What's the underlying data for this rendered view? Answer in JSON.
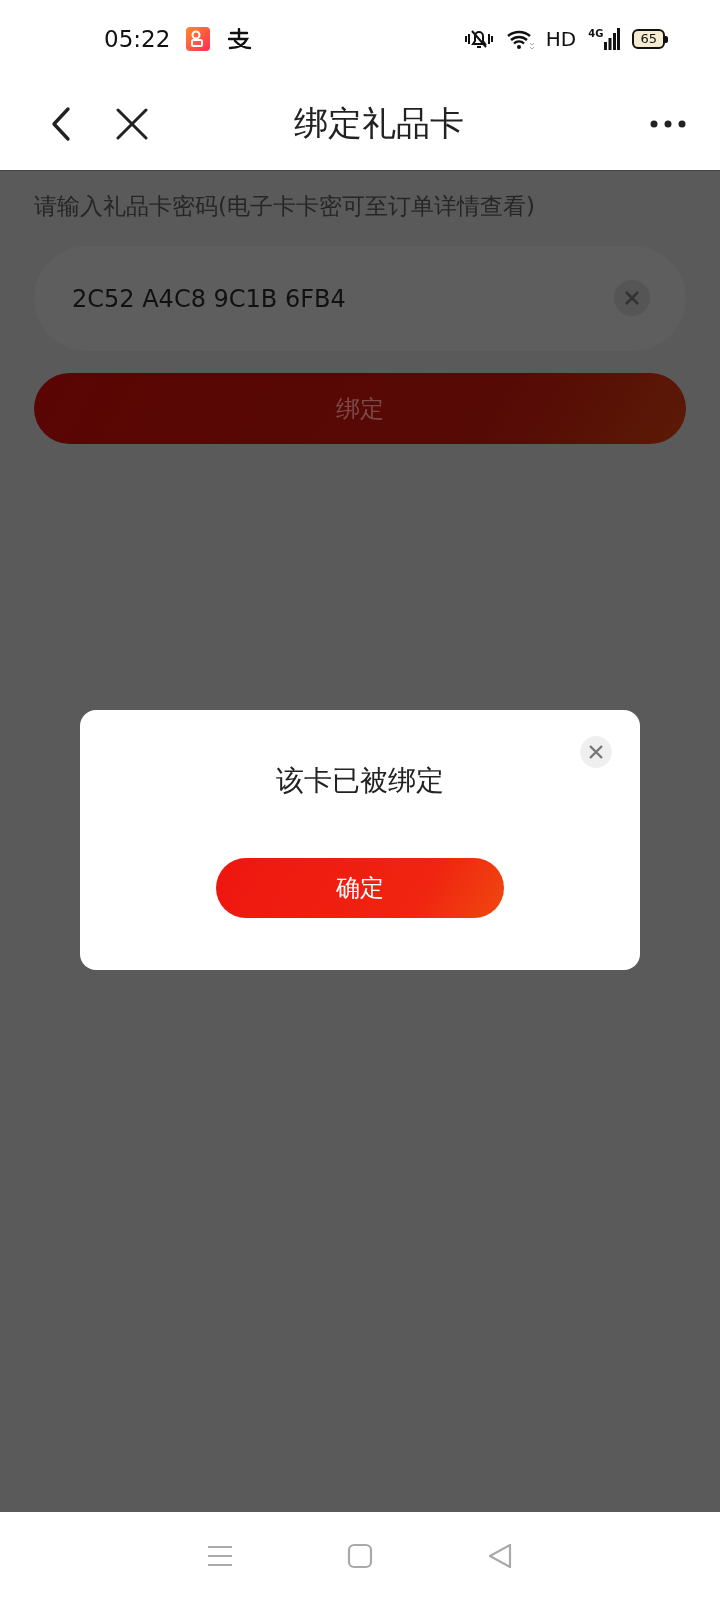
{
  "status_bar": {
    "time": "05:22",
    "network": "HD",
    "signal": "4G",
    "battery": "65"
  },
  "header": {
    "title": "绑定礼品卡"
  },
  "form": {
    "label": "请输入礼品卡密码(电子卡卡密可至订单详情查看)",
    "value": "2C52 A4C8 9C1B 6FB4",
    "button": "绑定"
  },
  "dialog": {
    "message": "该卡已被绑定",
    "button": "确定"
  }
}
